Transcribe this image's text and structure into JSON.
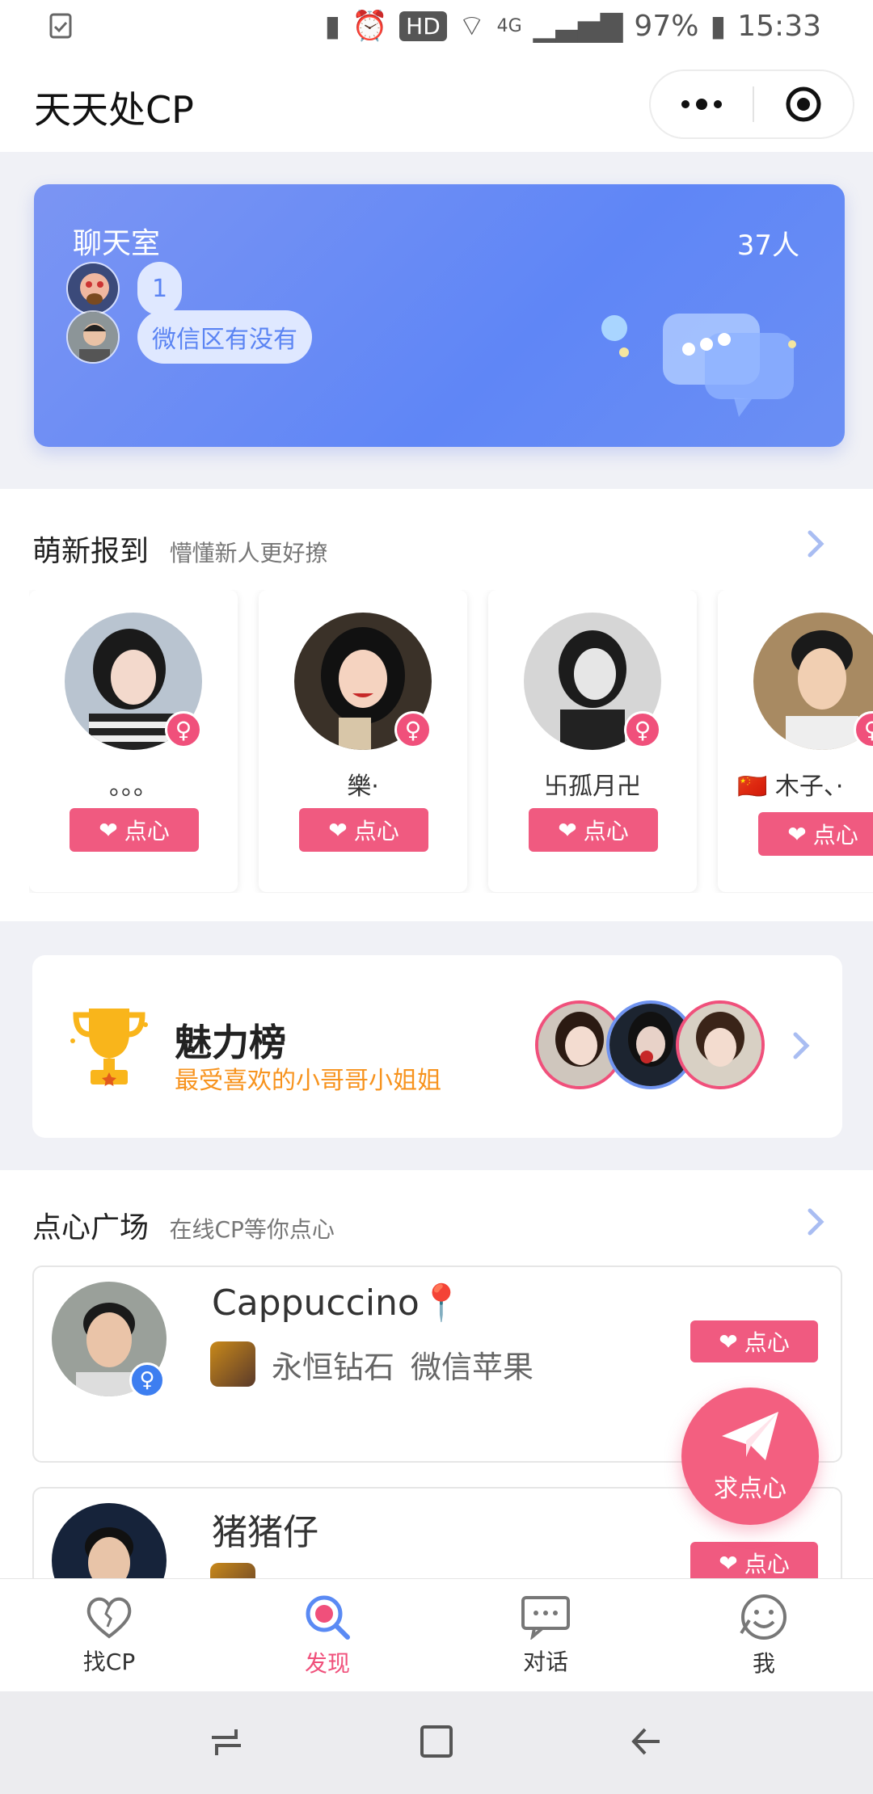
{
  "status_bar": {
    "battery": "97%",
    "time": "15:33",
    "hd": "HD",
    "network": "4G"
  },
  "header": {
    "title": "天天处CP"
  },
  "chat_room": {
    "title": "聊天室",
    "count": "37人",
    "messages": [
      {
        "text": "1"
      },
      {
        "text": "微信区有没有"
      }
    ]
  },
  "new_members": {
    "title": "萌新报到",
    "subtitle": "懵懂新人更好撩",
    "members": [
      {
        "name": "。。。",
        "like_label": "点心",
        "gender": "♀"
      },
      {
        "name": "樂·",
        "like_label": "点心",
        "gender": "♀"
      },
      {
        "name": "卐孤月卍",
        "like_label": "点心",
        "gender": "♀"
      },
      {
        "name": "🇨🇳 木子、·",
        "like_label": "点心",
        "gender": "♀"
      }
    ]
  },
  "charm": {
    "title": "魅力榜",
    "subtitle": "最受喜欢的小哥哥小姐姐"
  },
  "square": {
    "title": "点心广场",
    "subtitle": "在线CP等你点心",
    "posts": [
      {
        "name": "Cappuccino📍",
        "rank": "永恒钻石",
        "zone": "微信苹果",
        "like_label": "点心",
        "gender": "♀"
      },
      {
        "name": "猪猪仔",
        "rank": "",
        "zone": "",
        "like_label": "点心",
        "gender": ""
      }
    ]
  },
  "fab": {
    "label": "求点心"
  },
  "tabs": [
    {
      "label": "找CP"
    },
    {
      "label": "发现"
    },
    {
      "label": "对话"
    },
    {
      "label": "我"
    }
  ],
  "colors": {
    "accent": "#f0507b",
    "banner": "#6b8cf5",
    "charm_sub": "#f7931e"
  }
}
